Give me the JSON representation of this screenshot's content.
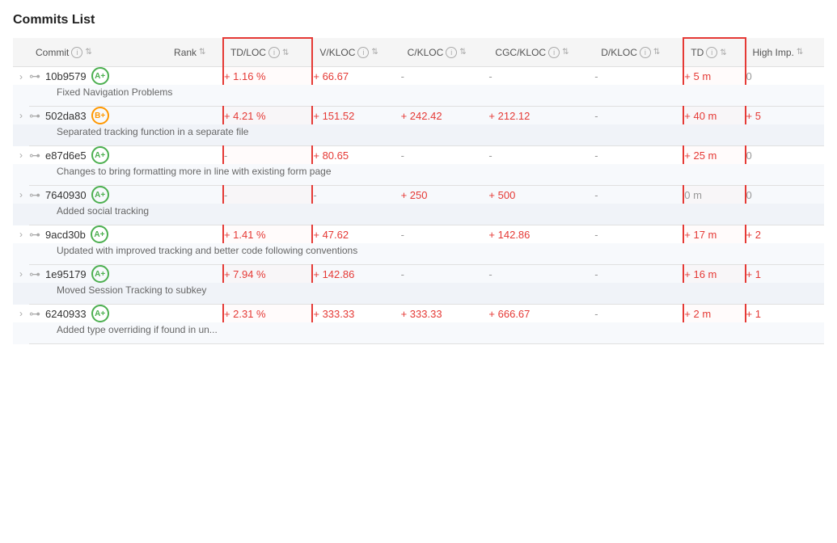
{
  "title": "Commits List",
  "columns": [
    {
      "id": "expand",
      "label": ""
    },
    {
      "id": "commit",
      "label": "Commit",
      "has_info": true,
      "has_sort": true
    },
    {
      "id": "rank",
      "label": "Rank",
      "has_info": false,
      "has_sort": true
    },
    {
      "id": "tdloc",
      "label": "TD/LOC",
      "has_info": true,
      "has_sort": true,
      "highlight": true
    },
    {
      "id": "vkloc",
      "label": "V/KLOC",
      "has_info": true,
      "has_sort": true
    },
    {
      "id": "ckloc",
      "label": "C/KLOC",
      "has_info": true,
      "has_sort": true
    },
    {
      "id": "cgckloc",
      "label": "CGC/KLOC",
      "has_info": true,
      "has_sort": true
    },
    {
      "id": "dkloc",
      "label": "D/KLOC",
      "has_info": true,
      "has_sort": true
    },
    {
      "id": "td",
      "label": "TD",
      "has_info": true,
      "has_sort": true,
      "highlight2": true
    },
    {
      "id": "highimp",
      "label": "High Imp.",
      "has_info": false,
      "has_sort": true
    }
  ],
  "rows": [
    {
      "id": "10b9579",
      "rank": "A+",
      "rank_class": "badge-a",
      "tdloc": "+ 1.16 %",
      "vkloc": "+ 66.67",
      "ckloc": "-",
      "cgckloc": "-",
      "dkloc": "-",
      "td": "+ 5 m",
      "highimp": "0",
      "highimp_class": "neutral",
      "description": "Fixed Navigation Problems"
    },
    {
      "id": "502da83",
      "rank": "B+",
      "rank_class": "badge-b",
      "tdloc": "+ 4.21 %",
      "vkloc": "+ 151.52",
      "ckloc": "+ 242.42",
      "cgckloc": "+ 212.12",
      "dkloc": "-",
      "td": "+ 40 m",
      "highimp": "+ 5",
      "highimp_class": "positive",
      "description": "Separated tracking function in a separate file"
    },
    {
      "id": "e87d6e5",
      "rank": "A+",
      "rank_class": "badge-a",
      "tdloc": "-",
      "vkloc": "+ 80.65",
      "ckloc": "-",
      "cgckloc": "-",
      "dkloc": "-",
      "td": "+ 25 m",
      "highimp": "0",
      "highimp_class": "neutral",
      "description": "Changes to bring formatting more in line with existing form page"
    },
    {
      "id": "7640930",
      "rank": "A+",
      "rank_class": "badge-a",
      "tdloc": "-",
      "vkloc": "-",
      "ckloc": "+ 250",
      "cgckloc": "+ 500",
      "dkloc": "-",
      "td": "0 m",
      "highimp": "0",
      "highimp_class": "neutral",
      "description": "Added social tracking"
    },
    {
      "id": "9acd30b",
      "rank": "A+",
      "rank_class": "badge-a",
      "tdloc": "+ 1.41 %",
      "vkloc": "+ 47.62",
      "ckloc": "-",
      "cgckloc": "+ 142.86",
      "dkloc": "-",
      "td": "+ 17 m",
      "highimp": "+ 2",
      "highimp_class": "positive",
      "description": "Updated with improved tracking and better code following conventions"
    },
    {
      "id": "1e95179",
      "rank": "A+",
      "rank_class": "badge-a",
      "tdloc": "+ 7.94 %",
      "vkloc": "+ 142.86",
      "ckloc": "-",
      "cgckloc": "-",
      "dkloc": "-",
      "td": "+ 16 m",
      "highimp": "+ 1",
      "highimp_class": "positive",
      "description": "Moved Session Tracking to subkey"
    },
    {
      "id": "6240933",
      "rank": "A+",
      "rank_class": "badge-a",
      "tdloc": "+ 2.31 %",
      "vkloc": "+ 333.33",
      "ckloc": "+ 333.33",
      "cgckloc": "+ 666.67",
      "dkloc": "-",
      "td": "+ 2 m",
      "highimp": "+ 1",
      "highimp_class": "positive",
      "description": "Added type overriding if found in un..."
    }
  ],
  "icons": {
    "chevron_right": "›",
    "commit_symbol": "⊶",
    "info": "i",
    "sort": "⇅"
  }
}
